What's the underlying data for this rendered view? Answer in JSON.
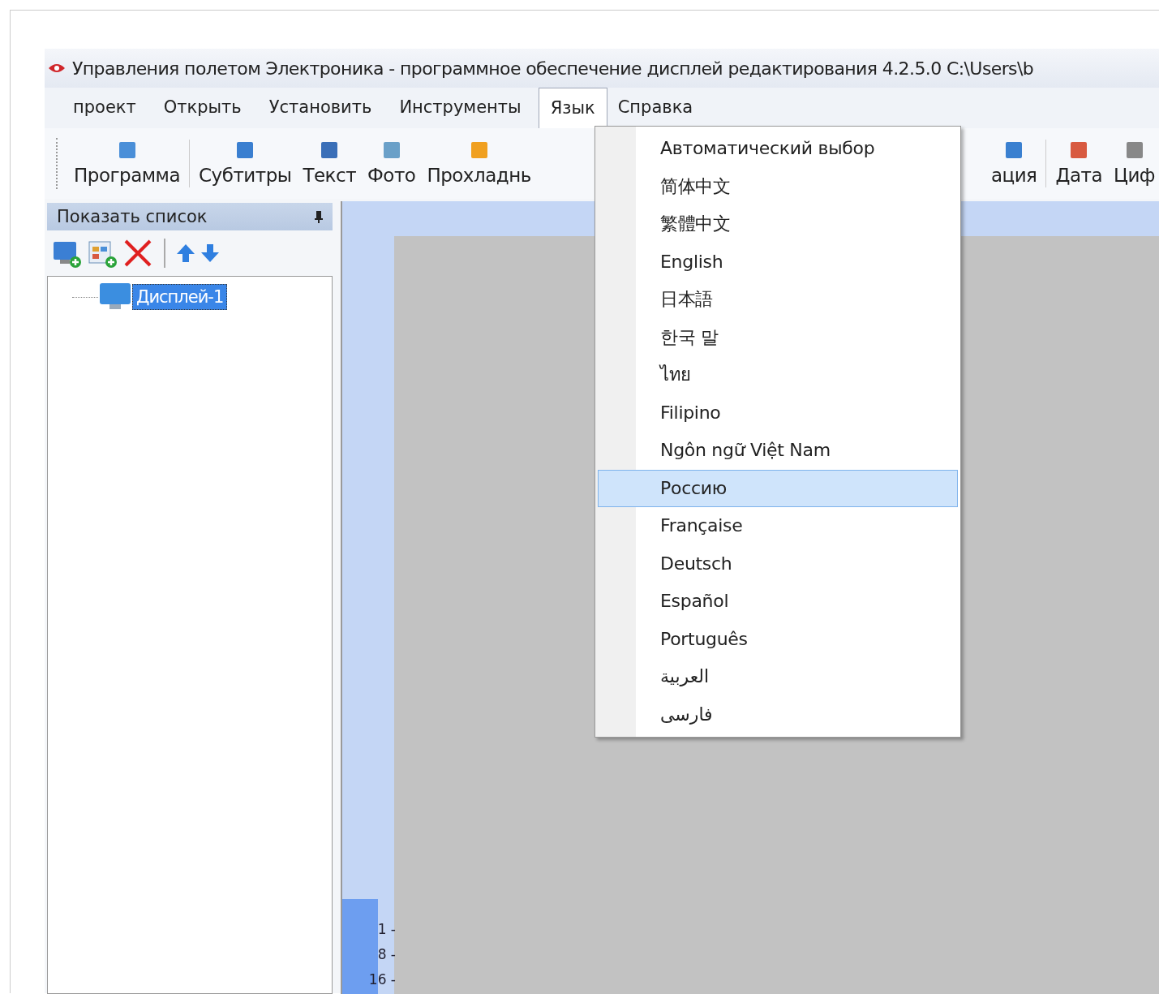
{
  "window": {
    "title": "Управления полетом Электроника - программное обеспечение дисплей редактирования 4.2.5.0 C:\\Users\\b"
  },
  "menu_bar": [
    {
      "label": "проект",
      "selected": false
    },
    {
      "label": "Открыть",
      "selected": false
    },
    {
      "label": "Установить",
      "selected": false
    },
    {
      "label": "Инструменты",
      "selected": false
    },
    {
      "label": "Язык",
      "selected": true
    },
    {
      "label": "Справка",
      "selected": false
    }
  ],
  "toolbar_left": [
    {
      "label": "Программа",
      "kind": "program"
    },
    {
      "label": "Субтитры",
      "kind": "subtitle"
    },
    {
      "label": "Текст",
      "kind": "text"
    },
    {
      "label": "Фото",
      "kind": "photo"
    },
    {
      "label": "Прохладнь",
      "kind": "flash"
    }
  ],
  "toolbar_right": [
    {
      "label": "ация",
      "kind": "animation"
    },
    {
      "label": "Дата",
      "kind": "date"
    },
    {
      "label": "Циф",
      "kind": "digit"
    }
  ],
  "panel": {
    "title": "Показать список",
    "tree": [
      {
        "label": "Дисплей-1",
        "selected": true
      }
    ]
  },
  "language_menu": [
    {
      "label": "Автоматический выбор",
      "selected": false
    },
    {
      "label": "简体中文",
      "selected": false
    },
    {
      "label": "繁體中文",
      "selected": false
    },
    {
      "label": "English",
      "selected": false
    },
    {
      "label": "日本語",
      "selected": false
    },
    {
      "label": "한국 말",
      "selected": false
    },
    {
      "label": "ไทย",
      "selected": false
    },
    {
      "label": "Filipino",
      "selected": false
    },
    {
      "label": "Ngôn ngữ Việt Nam",
      "selected": false
    },
    {
      "label": "Россию",
      "selected": true
    },
    {
      "label": "Française",
      "selected": false
    },
    {
      "label": "Deutsch",
      "selected": false
    },
    {
      "label": "Español",
      "selected": false
    },
    {
      "label": "Português",
      "selected": false
    },
    {
      "label": "العربية",
      "selected": false
    },
    {
      "label": "فارسی",
      "selected": false
    }
  ],
  "ruler": [
    "1 -",
    "8 -",
    "16 -"
  ]
}
